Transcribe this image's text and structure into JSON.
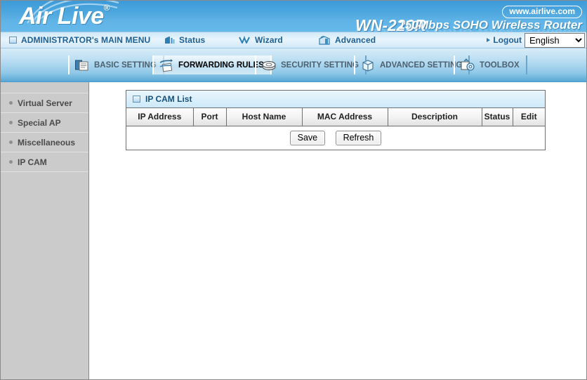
{
  "header": {
    "logo_text": "Air Live",
    "logo_reg": "®",
    "model": "WN-220R",
    "tagline": "150Mbps SOHO Wireless Router",
    "weburl": "www.airlive.com",
    "ghost_text": "150Mbps SOHO Wireless Router"
  },
  "menubar": {
    "admin_label": "ADMINISTRATOR's MAIN MENU",
    "status_label": "Status",
    "wizard_label": "Wizard",
    "advanced_label": "Advanced",
    "logout_label": "Logout",
    "language_selected": "English",
    "language_options": [
      "English"
    ],
    "icons": {
      "admin": "window-icon",
      "status": "signal-bars-icon",
      "wizard": "wand-icon",
      "advanced": "toolbox-icon"
    }
  },
  "tabs": [
    {
      "label": "BASIC SETTING",
      "icon": "documents-icon",
      "active": false
    },
    {
      "label": "FORWARDING RULES",
      "icon": "arrows-icon",
      "active": true
    },
    {
      "label": "SECURITY SETTING",
      "icon": "shield-disc-icon",
      "active": false
    },
    {
      "label": "ADVANCED SETTING",
      "icon": "cube-box-icon",
      "active": false
    },
    {
      "label": "TOOLBOX",
      "icon": "gear-tools-icon",
      "active": false
    }
  ],
  "sidebar": {
    "items": [
      {
        "label": "Virtual Server"
      },
      {
        "label": "Special AP"
      },
      {
        "label": "Miscellaneous"
      },
      {
        "label": "IP CAM"
      }
    ]
  },
  "panel": {
    "title": "IP CAM List",
    "title_icon": "square-bullet-icon",
    "table": {
      "columns": [
        "IP Address",
        "Port",
        "Host Name",
        "MAC Address",
        "Description",
        "Status",
        "Edit"
      ],
      "rows": []
    },
    "buttons": {
      "save": "Save",
      "refresh": "Refresh"
    }
  },
  "colors": {
    "banner_blue": "#4ca6de",
    "menu_text": "#1d5f93",
    "tab_active_text": "#000000",
    "tab_text": "#4c6070",
    "sidebar_bg": "#cbcbcb",
    "panel_border": "#6f6f6f",
    "panel_title_text": "#16527c"
  }
}
